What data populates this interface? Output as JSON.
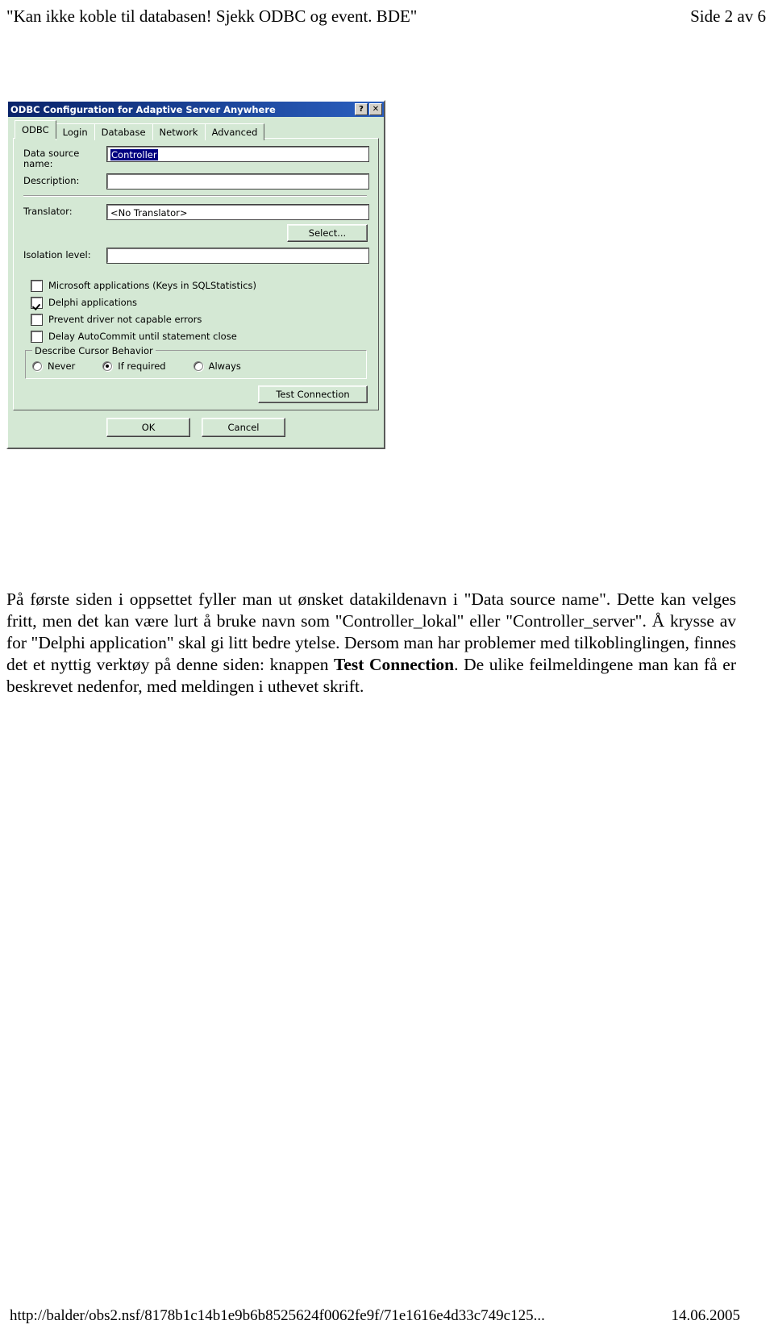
{
  "header": {
    "left": "\"Kan ikke koble til databasen! Sjekk ODBC og event. BDE\"",
    "right": "Side 2 av 6"
  },
  "dialog": {
    "title": "ODBC Configuration for Adaptive Server Anywhere",
    "help_button": "?",
    "close_button": "✕",
    "tabs": [
      {
        "label": "ODBC",
        "active": true
      },
      {
        "label": "Login",
        "active": false
      },
      {
        "label": "Database",
        "active": false
      },
      {
        "label": "Network",
        "active": false
      },
      {
        "label": "Advanced",
        "active": false
      }
    ],
    "fields": {
      "data_source_name_label_line1": "Data source",
      "data_source_name_label_line2": "name:",
      "data_source_name_value": "Controller",
      "description_label": "Description:",
      "description_value": "",
      "translator_label": "Translator:",
      "translator_value": "<No Translator>",
      "select_button": "Select...",
      "isolation_label": "Isolation level:",
      "isolation_value": ""
    },
    "checkboxes": [
      {
        "label": "Microsoft applications (Keys in SQLStatistics)",
        "checked": false
      },
      {
        "label": "Delphi applications",
        "checked": true
      },
      {
        "label": "Prevent driver not capable errors",
        "checked": false
      },
      {
        "label": "Delay AutoCommit until statement close",
        "checked": false
      }
    ],
    "cursor_group": {
      "title": "Describe Cursor Behavior",
      "options": [
        {
          "label": "Never",
          "selected": false
        },
        {
          "label": "If required",
          "selected": true
        },
        {
          "label": "Always",
          "selected": false
        }
      ]
    },
    "test_connection_button": "Test Connection",
    "ok_button": "OK",
    "cancel_button": "Cancel"
  },
  "body": {
    "part1": "På første siden i oppsettet fyller man ut ønsket datakildenavn i \"Data source name\". Dette kan velges fritt, men det kan være lurt å bruke navn som \"Controller_lokal\" eller \"Controller_server\". Å krysse av for \"Delphi application\" skal gi litt bedre ytelse. Dersom man har problemer med tilkoblinglingen, finnes det et nyttig verktøy på denne siden: knappen ",
    "bold": "Test Connection",
    "part2": ". De ulike feilmeldingene man kan få er beskrevet nedenfor, med meldingen i uthevet skrift."
  },
  "footer": {
    "url": "http://balder/obs2.nsf/8178b1c14b1e9b6b8525624f0062fe9f/71e1616e4d33c749c125...",
    "date": "14.06.2005"
  }
}
